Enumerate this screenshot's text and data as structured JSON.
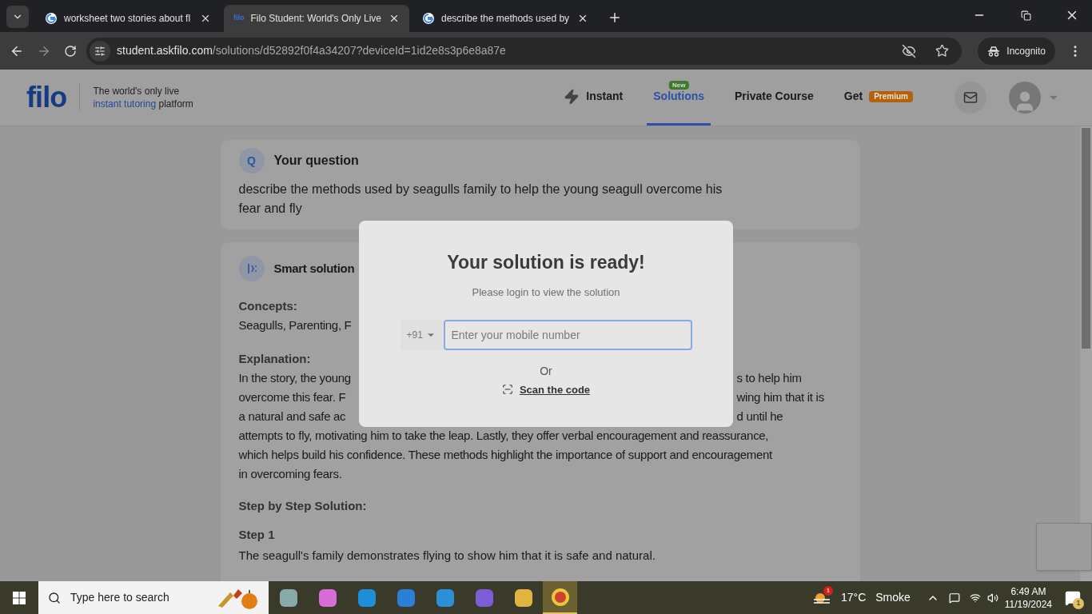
{
  "browser": {
    "tabs": [
      {
        "kind": "google",
        "title": "worksheet two stories about fl",
        "selected": false
      },
      {
        "kind": "site",
        "icon_text": "filo",
        "title": "Filo Student: World's Only Live",
        "selected": true
      },
      {
        "kind": "google",
        "title": "describe the methods used by",
        "selected": false
      }
    ],
    "url_host": "student.askfilo.com",
    "url_path": "/solutions/d52892f0f4a34207?deviceId=1id2e8s3p6e8a87e",
    "profile": "Incognito"
  },
  "site_header": {
    "logo": "filo",
    "tagline_1": "The world's only live",
    "tagline_highlight": "instant tutoring",
    "tagline_2": "platform",
    "nav": [
      {
        "label": "Instant",
        "selected": false,
        "kind": "bolt"
      },
      {
        "label": "Solutions",
        "selected": true,
        "badge": "New"
      },
      {
        "label": "Private Course",
        "selected": false
      },
      {
        "label": "Get",
        "selected": false,
        "badge": "Premium"
      }
    ]
  },
  "question": {
    "badge": "Q",
    "title": "Your question",
    "text": "describe the methods used by seagulls family to help the young seagull overcome his fear and fly"
  },
  "solution": {
    "title": "Smart solution",
    "concepts_label": "Concepts:",
    "concepts": "Seagulls, Parenting, F",
    "explanation_label": "Explanation:",
    "explanation_lines": [
      {
        "parts": [
          "In the story, the young",
          "s to help him"
        ]
      },
      {
        "parts": [
          "overcome this fear. F",
          "wing him that it is"
        ]
      },
      {
        "parts": [
          "a natural and safe ac",
          "d until he"
        ]
      },
      {
        "parts": [
          "attempts to fly, motivating him to take the leap. Lastly, they offer verbal encouragement and reassurance,"
        ]
      },
      {
        "parts": [
          "which helps build his confidence. These methods highlight the importance of support and encouragement"
        ]
      },
      {
        "parts": [
          "in overcoming fears."
        ]
      }
    ],
    "steps_label": "Step by Step Solution:",
    "steps": [
      {
        "title": "Step 1",
        "text": "The seagull's family demonstrates flying to show him that it is safe and natural."
      }
    ]
  },
  "login_modal": {
    "title": "Your solution is ready!",
    "subtitle": "Please login to view the solution",
    "country_code": "+91",
    "placeholder": "Enter your mobile number",
    "or": "Or",
    "scan_link": "Scan the code"
  },
  "taskbar": {
    "search_placeholder": "Type here to search",
    "weather_alert": "1",
    "temperature": "17°C",
    "weather": "Smoke",
    "time": "6:49 AM",
    "date": "11/19/2024",
    "notifications": "1"
  }
}
